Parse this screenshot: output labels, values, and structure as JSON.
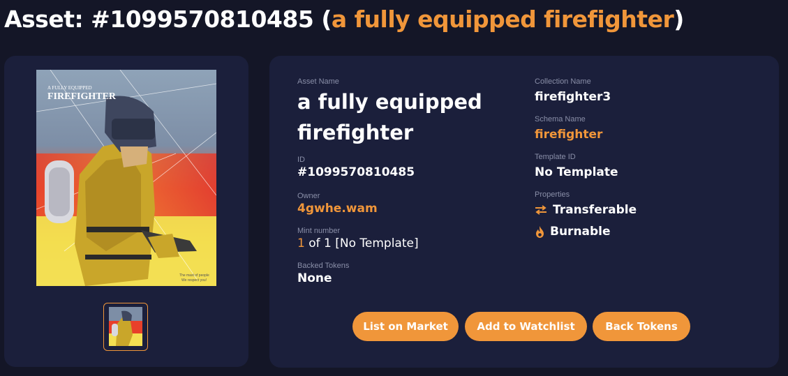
{
  "header": {
    "prefix": "Asset: ",
    "asset_id": "#1099570810485",
    "open_paren": " (",
    "asset_name": "a fully equipped firefighter",
    "close_paren": ")"
  },
  "image": {
    "subtitle_text": "A FULLY EQUIPPED",
    "title_text": "FIREFIGHTER",
    "caption_line1": "The mast of people",
    "caption_line2": "We respect you!"
  },
  "details": {
    "asset_name_label": "Asset Name",
    "asset_name_value": "a fully equipped firefighter",
    "id_label": "ID",
    "id_value": "#1099570810485",
    "owner_label": "Owner",
    "owner_value": "4gwhe.wam",
    "mint_label": "Mint number",
    "mint_current": "1",
    "mint_rest": " of 1 [No Template]",
    "backed_label": "Backed Tokens",
    "backed_value": "None",
    "collection_label": "Collection Name",
    "collection_value": "firefighter3",
    "schema_label": "Schema Name",
    "schema_value": "firefighter",
    "template_label": "Template ID",
    "template_value": "No Template",
    "properties_label": "Properties",
    "prop_transferable": "Transferable",
    "prop_burnable": "Burnable"
  },
  "icons": {
    "transferable": "transfer-arrows-icon",
    "burnable": "fire-icon"
  },
  "actions": {
    "list_label": "List on Market",
    "watch_label": "Add to Watchlist",
    "back_label": "Back Tokens"
  },
  "colors": {
    "background": "#141627",
    "card": "#1b1f3b",
    "accent": "#f0963a",
    "label": "#8a8fa8"
  }
}
